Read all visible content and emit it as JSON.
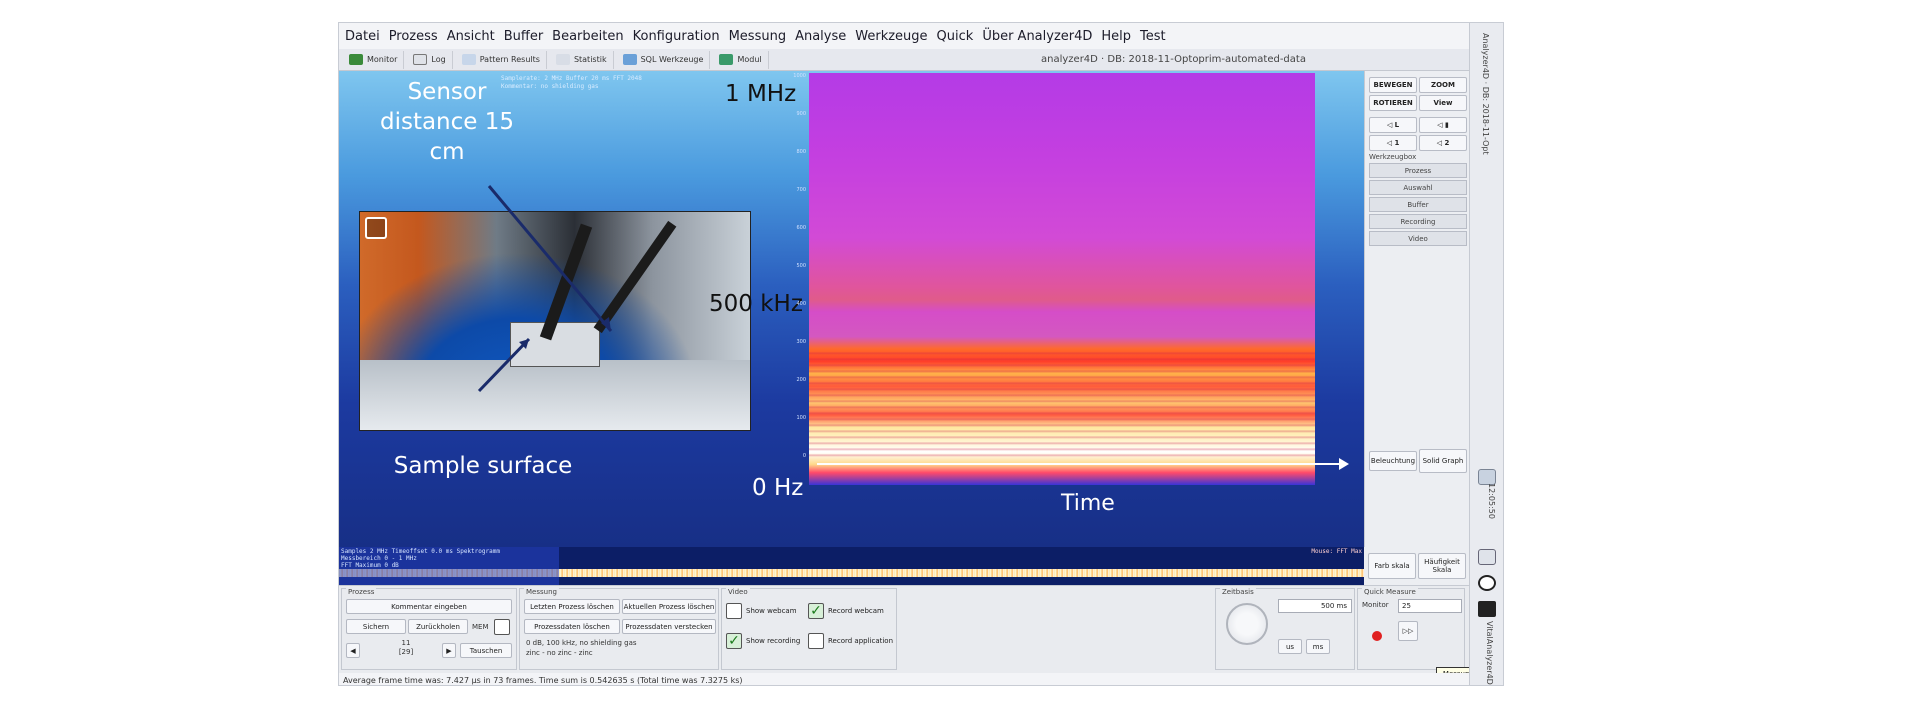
{
  "menu": [
    "Datei",
    "Prozess",
    "Ansicht",
    "Buffer",
    "Bearbeiten",
    "Konfiguration",
    "Messung",
    "Analyse",
    "Werkzeuge",
    "Quick",
    "Über Analyzer4D",
    "Help",
    "Test"
  ],
  "toolbar": {
    "items": [
      "Monitor",
      "Log",
      "Pattern Results",
      "Statistik",
      "SQL Werkzeuge",
      "Modul"
    ],
    "db_title": "analyzer4D · DB: 2018-11-Optoprim-automated-data"
  },
  "overlay": {
    "line1": "Samplerate: 2 MHz  Buffer 20 ms  FFT 2048",
    "line2": "Kommentar: no shielding gas",
    "sensor_label": "Sensor distance 15 cm",
    "sample_label": "Sample surface",
    "freq_top": "1 MHz",
    "freq_mid": "500 kHz",
    "freq_zero": "0 Hz",
    "time_label": "Time",
    "yticks": [
      "1000",
      "900",
      "800",
      "700",
      "600",
      "500",
      "400",
      "300",
      "200",
      "100",
      "0"
    ]
  },
  "right_panel": {
    "bewegen": "BEWEGEN",
    "zoom": "ZOOM",
    "rotieren": "ROTIEREN",
    "view": "View",
    "small_buttons": [
      "◁ L",
      "◁ ▮",
      "◁ 1",
      "◁ 2"
    ],
    "werkzeugbox": "Werkzeugbox",
    "tools": [
      "Prozess",
      "Auswahl",
      "Buffer",
      "Recording",
      "Video"
    ],
    "beleuchtung": "Beleuchtung",
    "solid_graph": "Solid Graph",
    "farb_skala": "Farb skala",
    "haeufigkeit": "Häufigkeit Skala"
  },
  "wave": {
    "text1": "Samples 2 MHz  Timeoffset 0.0 ms  Spektrogramm",
    "text2": "Messbereich 0 - 1 MHz",
    "text3": "FFT Maximum 0 dB",
    "right_text": "Mouse: FFT Max"
  },
  "bottom": {
    "prozess_title": "Prozess",
    "kommentar_btn": "Kommentar eingeben",
    "sichern_btn": "Sichern",
    "zurueckholen_btn": "Zurückholen",
    "mem_label": "MEM",
    "counter_top": "11",
    "counter_bottom": "[29]",
    "tauschen_btn": "Tauschen",
    "messung_title": "Messung",
    "letzten_btn": "Letzten Prozess löschen",
    "aktuellen_btn": "Aktuellen Prozess löschen",
    "prozessdaten_btn": "Prozessdaten löschen",
    "prozessdaten_verstecken_btn": "Prozessdaten verstecken",
    "messung_info1": "0 dB, 100 kHz, no shielding gas",
    "messung_info2": "zinc - no zinc - zinc",
    "video_title": "Video",
    "show_webcam": "Show webcam",
    "record_webcam": "Record webcam",
    "show_recording": "Show recording",
    "record_application": "Record application",
    "zeitbasis_title": "Zeitbasis",
    "zeitbasis_value": "500 ms",
    "unit_us": "us",
    "unit_ms": "ms",
    "quick_title": "Quick Measure",
    "monitor_label": "Monitor",
    "monitor_value": "25",
    "tooltip": "Messung erneut abspielen"
  },
  "status": "Average frame time was: 7.427 µs in 73 frames. Time sum is 0.542635 s (Total time was 7.3275 ks)",
  "strip": {
    "vtext": "Analyzer4D · DB: 2018-11-Opt",
    "time": "12:05:50",
    "name": "VitalAnalyzer4D"
  }
}
